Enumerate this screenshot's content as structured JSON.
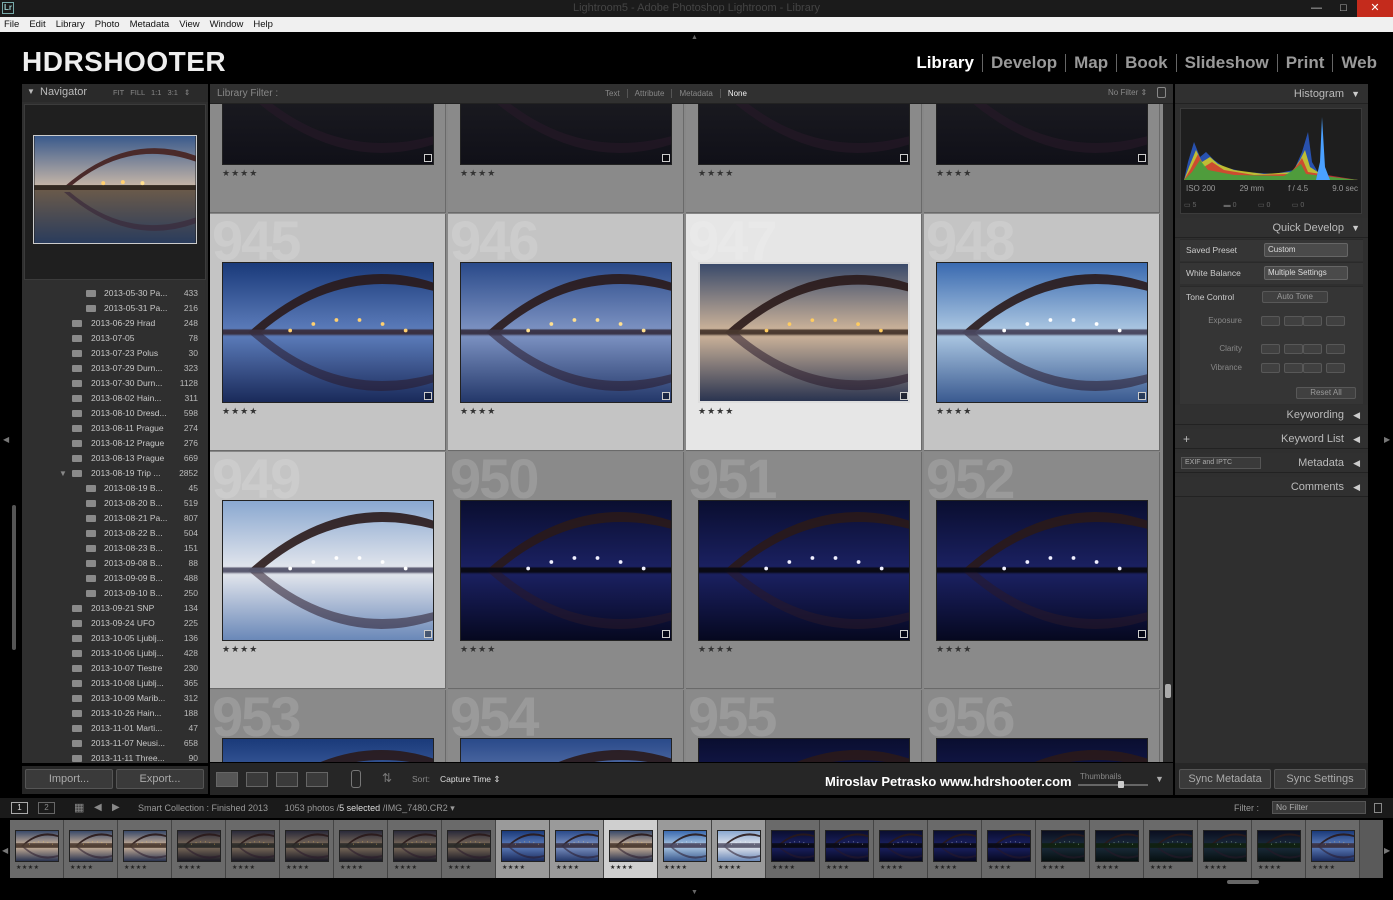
{
  "window": {
    "title": "Lightroom5 - Adobe Photoshop Lightroom - Library",
    "app_icon": "Lr"
  },
  "menu": [
    "File",
    "Edit",
    "Library",
    "Photo",
    "Metadata",
    "View",
    "Window",
    "Help"
  ],
  "brand": "HDRSHOOTER",
  "modules": [
    {
      "label": "Library",
      "active": true
    },
    {
      "label": "Develop",
      "active": false
    },
    {
      "label": "Map",
      "active": false
    },
    {
      "label": "Book",
      "active": false
    },
    {
      "label": "Slideshow",
      "active": false
    },
    {
      "label": "Print",
      "active": false
    },
    {
      "label": "Web",
      "active": false
    }
  ],
  "navigator": {
    "title": "Navigator",
    "options": "FIT FILL 1:1 3:1 ⇕"
  },
  "folders": [
    {
      "name": "2013-05-30 Pa...",
      "count": "433",
      "sub": true
    },
    {
      "name": "2013-05-31 Pa...",
      "count": "216",
      "sub": true
    },
    {
      "name": "2013-06-29 Hrad",
      "count": "248",
      "sub": false
    },
    {
      "name": "2013-07-05",
      "count": "78",
      "sub": false
    },
    {
      "name": "2013-07-23 Polus",
      "count": "30",
      "sub": false
    },
    {
      "name": "2013-07-29 Durn...",
      "count": "323",
      "sub": false
    },
    {
      "name": "2013-07-30 Durn...",
      "count": "1128",
      "sub": false
    },
    {
      "name": "2013-08-02 Hain...",
      "count": "311",
      "sub": false
    },
    {
      "name": "2013-08-10 Dresd...",
      "count": "598",
      "sub": false
    },
    {
      "name": "2013-08-11 Prague",
      "count": "274",
      "sub": false
    },
    {
      "name": "2013-08-12 Prague",
      "count": "276",
      "sub": false
    },
    {
      "name": "2013-08-13 Prague",
      "count": "669",
      "sub": false
    },
    {
      "name": "2013-08-19 Trip ...",
      "count": "2852",
      "sub": false,
      "open": true
    },
    {
      "name": "2013-08-19 B...",
      "count": "45",
      "sub": true
    },
    {
      "name": "2013-08-20 B...",
      "count": "519",
      "sub": true
    },
    {
      "name": "2013-08-21 Pa...",
      "count": "807",
      "sub": true
    },
    {
      "name": "2013-08-22 B...",
      "count": "504",
      "sub": true
    },
    {
      "name": "2013-08-23 B...",
      "count": "151",
      "sub": true
    },
    {
      "name": "2013-09-08 B...",
      "count": "88",
      "sub": true
    },
    {
      "name": "2013-09-09 B...",
      "count": "488",
      "sub": true
    },
    {
      "name": "2013-09-10 B...",
      "count": "250",
      "sub": true
    },
    {
      "name": "2013-09-21 SNP",
      "count": "134",
      "sub": false
    },
    {
      "name": "2013-09-24 UFO",
      "count": "225",
      "sub": false
    },
    {
      "name": "2013-10-05 Ljublj...",
      "count": "136",
      "sub": false
    },
    {
      "name": "2013-10-06 Ljublj...",
      "count": "428",
      "sub": false
    },
    {
      "name": "2013-10-07 Tiestre",
      "count": "230",
      "sub": false
    },
    {
      "name": "2013-10-08 Ljublj...",
      "count": "365",
      "sub": false
    },
    {
      "name": "2013-10-09 Marib...",
      "count": "312",
      "sub": false
    },
    {
      "name": "2013-10-26 Hain...",
      "count": "188",
      "sub": false
    },
    {
      "name": "2013-11-01 Marti...",
      "count": "47",
      "sub": false
    },
    {
      "name": "2013-11-07 Neusi...",
      "count": "658",
      "sub": false
    },
    {
      "name": "2013-11-11 Three...",
      "count": "90",
      "sub": false
    }
  ],
  "left_buttons": {
    "import": "Import...",
    "export": "Export..."
  },
  "library_filter": {
    "label": "Library Filter :",
    "tabs": [
      "Text",
      "Attribute",
      "Metadata",
      "None"
    ],
    "selected": "None",
    "preset": "No Filter ⇕"
  },
  "grid": {
    "rows": [
      [
        {
          "num": "",
          "rating": "★★★★",
          "look": "night-top"
        },
        {
          "num": "",
          "rating": "★★★★",
          "look": "night-top"
        },
        {
          "num": "",
          "rating": "★★★★",
          "look": "night-top"
        },
        {
          "num": "",
          "rating": "★★★★",
          "look": "night-top"
        }
      ],
      [
        {
          "num": "945",
          "rating": "★★★★",
          "look": "dusk"
        },
        {
          "num": "946",
          "rating": "★★★★",
          "look": "dusk2"
        },
        {
          "num": "947",
          "rating": "★★★★",
          "look": "warm",
          "selected": true
        },
        {
          "num": "948",
          "rating": "★★★★",
          "look": "bright"
        }
      ],
      [
        {
          "num": "949",
          "rating": "★★★★",
          "look": "pale"
        },
        {
          "num": "950",
          "rating": "★★★★",
          "look": "night"
        },
        {
          "num": "951",
          "rating": "★★★★",
          "look": "night"
        },
        {
          "num": "952",
          "rating": "★★★★",
          "look": "night"
        }
      ],
      [
        {
          "num": "953",
          "rating": "",
          "look": "dusk"
        },
        {
          "num": "954",
          "rating": "",
          "look": "dusk2"
        },
        {
          "num": "955",
          "rating": "",
          "look": "night"
        },
        {
          "num": "956",
          "rating": "",
          "look": "night"
        }
      ]
    ]
  },
  "toolbar": {
    "sort_label": "Sort:",
    "sort_value": "Capture Time ⇕",
    "watermark": "Miroslav  Petrasko  www.hdrshooter.com",
    "thumbnails_label": "Thumbnails"
  },
  "right": {
    "histogram": "Histogram",
    "hist_info": {
      "iso": "ISO 200",
      "focal": "29 mm",
      "aperture": "f / 4.5",
      "shutter": "9.0 sec"
    },
    "quick_develop": "Quick Develop",
    "saved_preset_label": "Saved Preset",
    "saved_preset_value": "Custom",
    "white_balance_label": "White Balance",
    "white_balance_value": "Multiple Settings",
    "tone_control_label": "Tone Control",
    "auto_tone": "Auto Tone",
    "exposure": "Exposure",
    "clarity": "Clarity",
    "vibrance": "Vibrance",
    "reset_all": "Reset All",
    "keywording": "Keywording",
    "keyword_list": "Keyword List",
    "metadata": "Metadata",
    "metadata_preset": "EXIF and IPTC",
    "comments": "Comments",
    "sync_metadata": "Sync Metadata",
    "sync_settings": "Sync Settings"
  },
  "filmstrip_bar": {
    "collection": "Smart Collection : Finished 2013",
    "photos": "1053 photos /",
    "selected": "5 selected",
    "file": "/IMG_7480.CR2 ▾",
    "filter_label": "Filter :",
    "filter_value": "No Filter"
  },
  "filmstrip": [
    {
      "look": "warm",
      "state": ""
    },
    {
      "look": "warm",
      "state": ""
    },
    {
      "look": "warm",
      "state": ""
    },
    {
      "look": "warm2",
      "state": ""
    },
    {
      "look": "warm2",
      "state": ""
    },
    {
      "look": "warm2",
      "state": ""
    },
    {
      "look": "warm2",
      "state": ""
    },
    {
      "look": "warm2",
      "state": ""
    },
    {
      "look": "warm2",
      "state": ""
    },
    {
      "look": "dusk",
      "state": "sel"
    },
    {
      "look": "dusk2",
      "state": "sel"
    },
    {
      "look": "warm",
      "state": "active"
    },
    {
      "look": "bright",
      "state": "sel"
    },
    {
      "look": "pale",
      "state": "sel"
    },
    {
      "look": "night",
      "state": ""
    },
    {
      "look": "night",
      "state": ""
    },
    {
      "look": "night",
      "state": ""
    },
    {
      "look": "night",
      "state": ""
    },
    {
      "look": "night",
      "state": ""
    },
    {
      "look": "green",
      "state": ""
    },
    {
      "look": "green",
      "state": ""
    },
    {
      "look": "green",
      "state": ""
    },
    {
      "look": "green",
      "state": ""
    },
    {
      "look": "green",
      "state": ""
    },
    {
      "look": "dusk",
      "state": ""
    }
  ],
  "filmstrip_rating": "★★★★",
  "colors": {
    "accent": "#ffffff",
    "panel": "#2f2f2f",
    "grid": "#878787"
  }
}
